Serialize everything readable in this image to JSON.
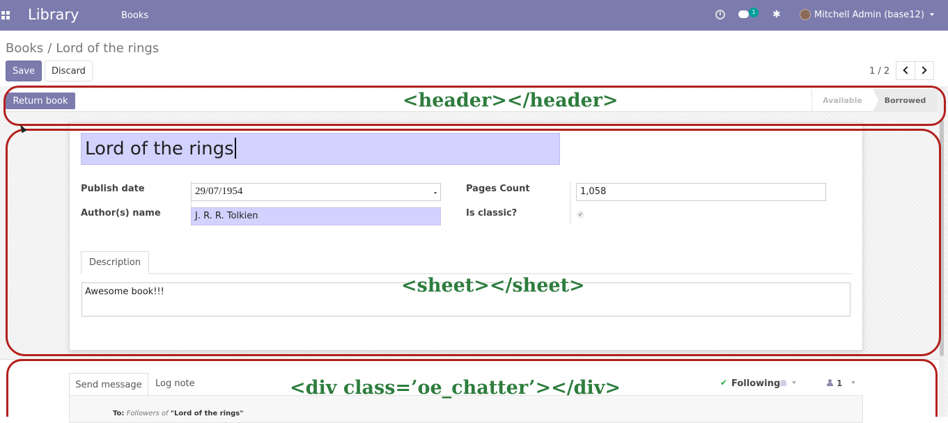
{
  "topbar": {
    "brand": "Library",
    "menu_item": "Books",
    "chat_badge": "1",
    "user_name": "Mitchell Admin (base12)",
    "bg_color": "#7c7bad"
  },
  "control_panel": {
    "breadcrumb_parent": "Books",
    "breadcrumb_separator": "/",
    "breadcrumb_current": "Lord of the rings",
    "save_label": "Save",
    "discard_label": "Discard",
    "pager_value": "1 / 2"
  },
  "header": {
    "return_book_label": "Return book",
    "stages": [
      "Available",
      "Borrowed"
    ],
    "active_stage": "Borrowed"
  },
  "sheet": {
    "title": "Lord of the rings",
    "fields": {
      "publish_date_label": "Publish date",
      "publish_date_value": "29/07/1954",
      "authors_label": "Author(s) name",
      "authors_value": "J. R. R. Tolkien",
      "pages_label": "Pages Count",
      "pages_value": "1,058",
      "is_classic_label": "Is classic?",
      "is_classic_value": true
    },
    "tab_label": "Description",
    "description": "Awesome book!!!"
  },
  "chatter": {
    "send_message_label": "Send message",
    "log_note_label": "Log note",
    "following_label": "Following",
    "followers_count": "1",
    "to_prefix": "To:",
    "to_followers": "Followers of",
    "to_record": "\"Lord of the rings\""
  },
  "annotations": {
    "header": "<header></header>",
    "sheet": "<sheet></sheet>",
    "chatter": "<div  class=’oe_chatter’></div>",
    "color": "#b3201d",
    "text_color": "#2e7d3e"
  }
}
